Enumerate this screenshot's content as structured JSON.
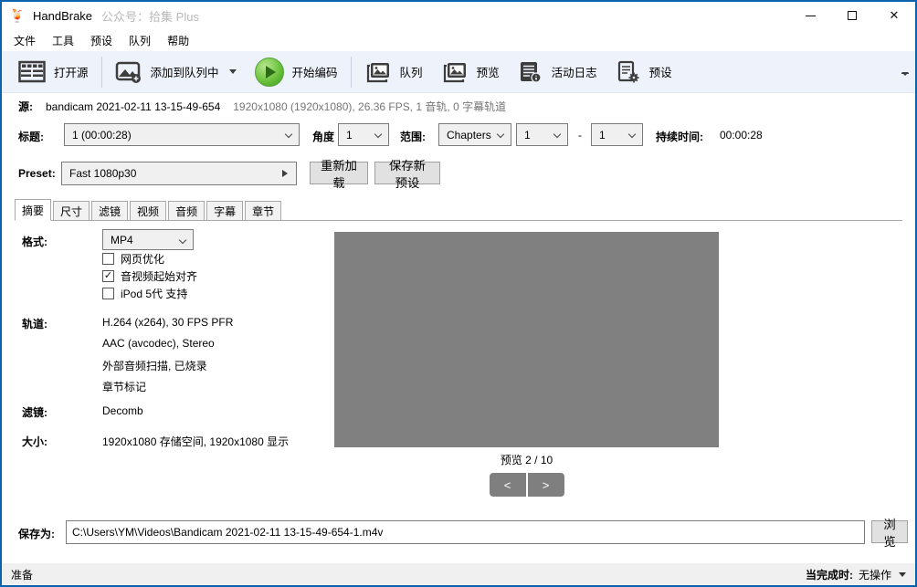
{
  "window": {
    "app_title": "HandBrake",
    "app_title_suffix": "公众号：拾集 Plus"
  },
  "icons": {
    "logo": "🍹",
    "close": "✕",
    "check": "✓"
  },
  "menu": {
    "items": [
      "文件",
      "工具",
      "预设",
      "队列",
      "帮助"
    ]
  },
  "toolbar": {
    "open_source": "打开源",
    "add_to_queue": "添加到队列中",
    "start_encode": "开始编码",
    "queue": "队列",
    "preview": "预览",
    "activity_log": "活动日志",
    "presets": "预设"
  },
  "source": {
    "label": "源:",
    "name": "bandicam 2021-02-11 13-15-49-654",
    "details": "1920x1080 (1920x1080), 26.36 FPS, 1 音轨, 0 字幕轨道"
  },
  "title_row": {
    "label": "标题:",
    "title_value": "1 (00:00:28)",
    "angle_label": "角度",
    "angle_value": "1",
    "range_label": "范围:",
    "range_type": "Chapters",
    "range_start": "1",
    "range_sep": "-",
    "range_end": "1",
    "duration_label": "持续时间:",
    "duration_value": "00:00:28"
  },
  "preset_row": {
    "label": "Preset:",
    "value": "Fast 1080p30",
    "reload": "重新加载",
    "save_new": "保存新预设"
  },
  "tabs": {
    "active_index": 0,
    "items": [
      "摘要",
      "尺寸",
      "滤镜",
      "视频",
      "音频",
      "字幕",
      "章节"
    ]
  },
  "summary": {
    "format_label": "格式:",
    "format_value": "MP4",
    "checkboxes": [
      {
        "label": "网页优化",
        "checked": false
      },
      {
        "label": "音视频起始对齐",
        "checked": true
      },
      {
        "label": "iPod 5代 支持",
        "checked": false
      }
    ],
    "tracks_label": "轨道:",
    "tracks": [
      "H.264 (x264), 30 FPS PFR",
      "AAC (avcodec), Stereo",
      "外部音频扫描, 已烧录",
      "章节标记"
    ],
    "filters_label": "滤镜:",
    "filters_value": "Decomb",
    "size_label": "大小:",
    "size_value": "1920x1080 存储空间, 1920x1080 显示"
  },
  "preview": {
    "counter": "预览 2 / 10",
    "prev": "<",
    "next": ">"
  },
  "save": {
    "label": "保存为:",
    "path": "C:\\Users\\YM\\Videos\\Bandicam 2021-02-11 13-15-49-654-1.m4v",
    "browse": "浏览"
  },
  "statusbar": {
    "status": "准备",
    "when_done_label": "当完成时:",
    "when_done_value": "无操作"
  },
  "colors": {
    "window_border": "#0a63ac",
    "toolbar_bg": "#eef3fb",
    "preview_gray": "#808080",
    "status_bg": "#f0f0f0",
    "play_green": "#6cc23e"
  }
}
